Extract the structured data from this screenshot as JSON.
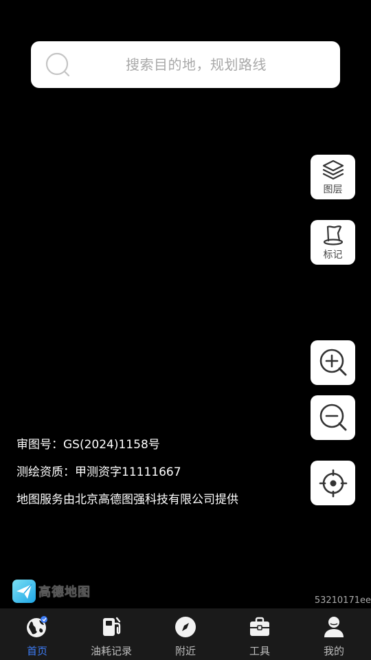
{
  "search": {
    "placeholder": "搜索目的地，规划路线"
  },
  "map_controls": {
    "layers_label": "图层",
    "marks_label": "标记",
    "zoom_in_icon": "zoom-in-icon",
    "zoom_out_icon": "zoom-out-icon",
    "locate_icon": "locate-icon"
  },
  "map_info": {
    "approval": "审图号：GS(2024)1158号",
    "surveying": "测绘资质：甲测资字11111667",
    "provider": "地图服务由北京高德图强科技有限公司提供"
  },
  "logo": {
    "text": "高德地图"
  },
  "version": "53210171ee",
  "tabs": [
    {
      "label": "首页",
      "icon": "globe-icon",
      "active": true
    },
    {
      "label": "油耗记录",
      "icon": "fuel-pump-icon",
      "active": false
    },
    {
      "label": "附近",
      "icon": "compass-icon",
      "active": false
    },
    {
      "label": "工具",
      "icon": "toolbox-icon",
      "active": false
    },
    {
      "label": "我的",
      "icon": "user-icon",
      "active": false
    }
  ],
  "colors": {
    "accent": "#3d7cf5",
    "background": "#000000",
    "tab_bar": "#1a1a1a"
  }
}
